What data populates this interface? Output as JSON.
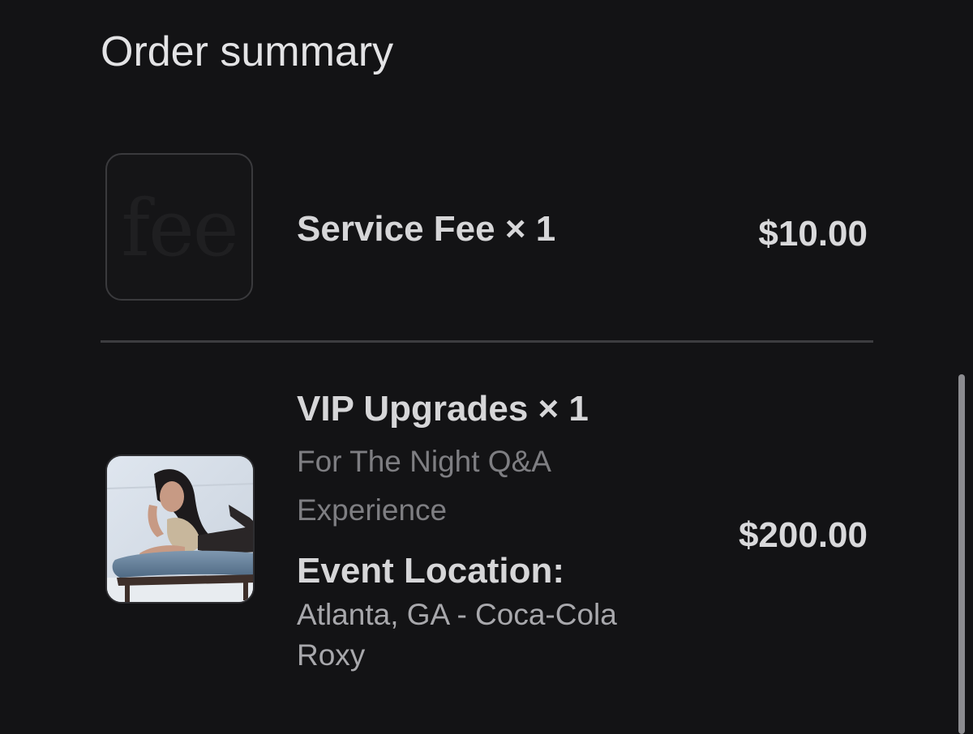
{
  "header": {
    "title": "Order summary"
  },
  "items": [
    {
      "thumbnail_text": "fee",
      "name": "Service Fee × 1",
      "price": "$10.00"
    },
    {
      "name": "VIP Upgrades × 1",
      "subtitle_line1": "For The Night Q&A",
      "subtitle_line2": "Experience",
      "location_label": "Event Location:",
      "location_line1": "Atlanta, GA - Coca-Cola",
      "location_line2": "Roxy",
      "price": "$200.00"
    }
  ],
  "colors": {
    "background": "#131315",
    "title_text": "#e3e3e5",
    "primary_text": "#d6d6d8",
    "secondary_text": "#7e7e82",
    "divider": "#3d3d40"
  }
}
